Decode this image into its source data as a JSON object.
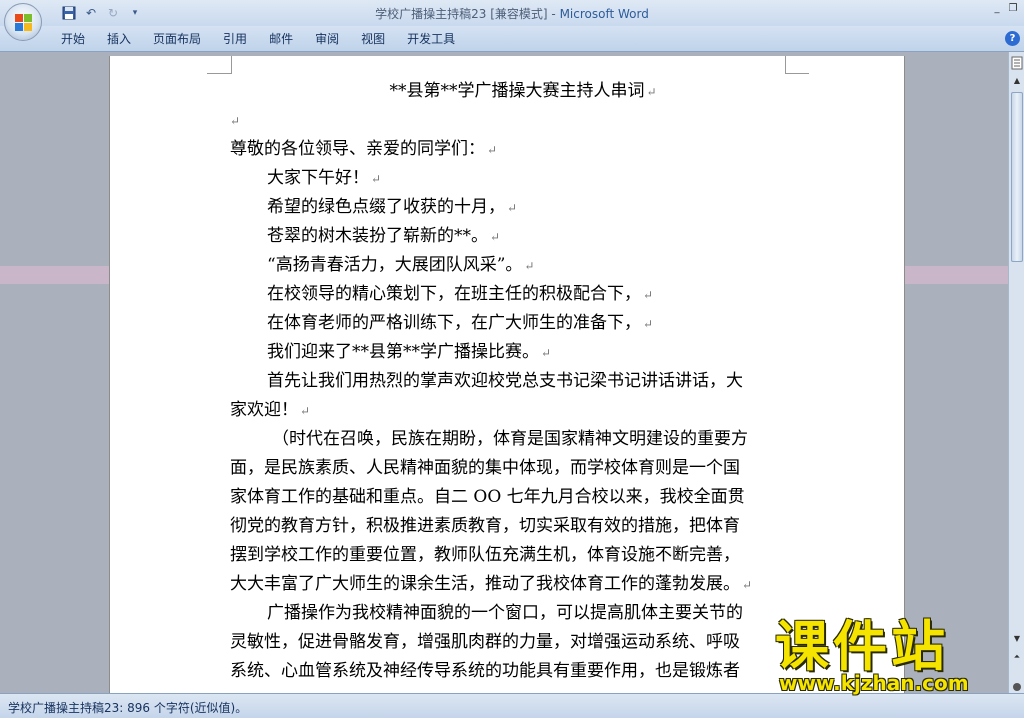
{
  "window": {
    "title_doc": "学校广播操主持稿23 [兼容模式] - ",
    "title_app": "Microsoft Word",
    "controls": [
      "_",
      "❐"
    ]
  },
  "quick_access": {
    "save_icon": "save-icon",
    "undo_icon": "undo-icon",
    "redo_icon": "redo-icon",
    "customize_icon": "customize-icon"
  },
  "ribbon": {
    "tabs": [
      {
        "label": "开始"
      },
      {
        "label": "插入"
      },
      {
        "label": "页面布局"
      },
      {
        "label": "引用"
      },
      {
        "label": "邮件"
      },
      {
        "label": "审阅"
      },
      {
        "label": "视图"
      },
      {
        "label": "开发工具"
      }
    ],
    "help": "?"
  },
  "document": {
    "title": "**县第**学广播操大赛主持人串词",
    "empty_mark": "↵",
    "lines": {
      "l1": "尊敬的各位领导、亲爱的同学们：",
      "l2": "大家下午好！",
      "l3": "希望的绿色点缀了收获的十月，",
      "l4": "苍翠的树木装扮了崭新的**。",
      "l5": "“高扬青春活力，大展团队风采”。",
      "l6": "在校领导的精心策划下，在班主任的积极配合下，",
      "l7": "在体育老师的严格训练下，在广大师生的准备下，",
      "l8": "我们迎来了**县第**学广播操比赛。",
      "p1_line1": "首先让我们用热烈的掌声欢迎校党总支书记梁书记讲话讲话，大",
      "p1_line2": "家欢迎！",
      "p2": [
        "（时代在召唤，民族在期盼，体育是国家精神文明建设的重要方",
        "面，是民族素质、人民精神面貌的集中体现，而学校体育则是一个国",
        "家体育工作的基础和重点。自二 OO 七年九月合校以来，我校全面贯",
        "彻党的教育方针，积极推进素质教育，切实采取有效的措施，把体育",
        "摆到学校工作的重要位置，教师队伍充满生机，体育设施不断完善，",
        "大大丰富了广大师生的课余生活，推动了我校体育工作的蓬勃发展。"
      ],
      "p3": [
        "广播操作为我校精神面貌的一个窗口，可以提高肌体主要关节的",
        "灵敏性，促进骨骼发育，增强肌肉群的力量，对增强运动系统、呼吸",
        "系统、心血管系统及神经传导系统的功能具有重要作用，也是锻炼者"
      ]
    },
    "para_mark": "↵"
  },
  "statusbar": {
    "text": "学校广播操主持稿23: 896 个字符(近似值)。"
  },
  "watermark": {
    "main": "课件站",
    "url": "www.kjzhan.com"
  }
}
